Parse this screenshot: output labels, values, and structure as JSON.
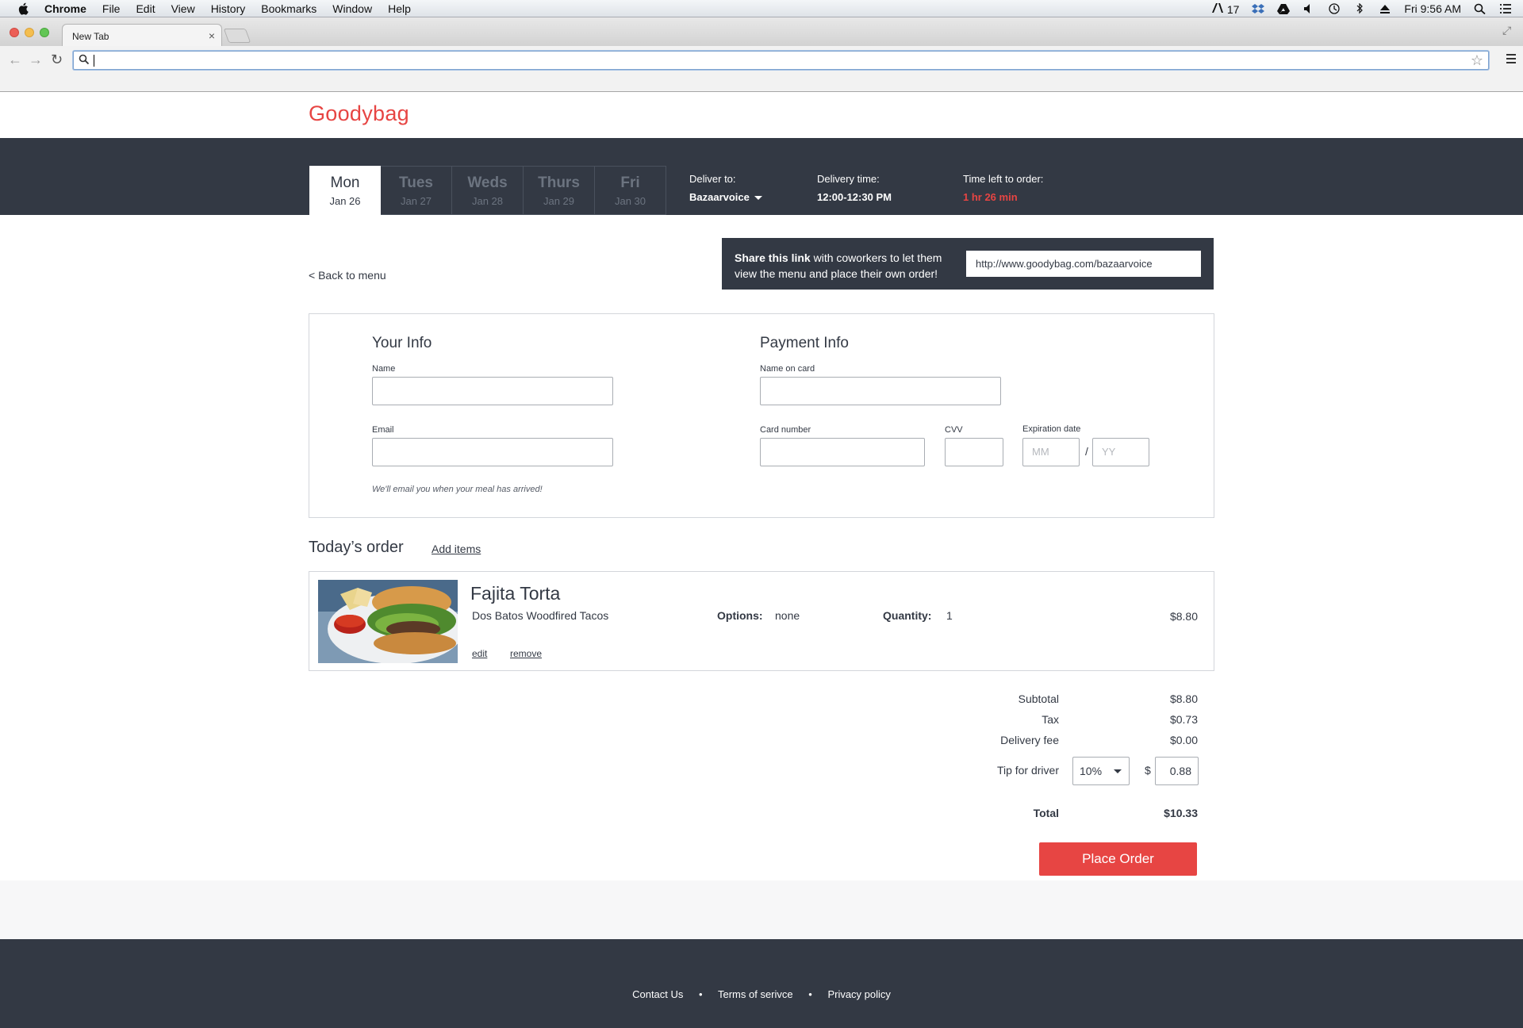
{
  "menubar": {
    "app": "Chrome",
    "items": [
      "File",
      "Edit",
      "View",
      "History",
      "Bookmarks",
      "Window",
      "Help"
    ],
    "adobe_count": "17",
    "clock": "Fri 9:56 AM"
  },
  "browser": {
    "tab_title": "New Tab",
    "tab_close": "×",
    "address_value": ""
  },
  "site": {
    "logo": "Goodybag",
    "days": [
      {
        "name": "Mon",
        "date": "Jan 26"
      },
      {
        "name": "Tues",
        "date": "Jan 27"
      },
      {
        "name": "Weds",
        "date": "Jan 28"
      },
      {
        "name": "Thurs",
        "date": "Jan 29"
      },
      {
        "name": "Fri",
        "date": "Jan 30"
      }
    ],
    "deliver_to_label": "Deliver to:",
    "deliver_to_value": "Bazaarvoice",
    "delivery_time_label": "Delivery time:",
    "delivery_time_value": "12:00-12:30 PM",
    "time_left_label": "Time left to order:",
    "time_left_value": "1 hr 26 min",
    "accent_color": "#e74543"
  },
  "share": {
    "back_link": "< Back to menu",
    "bold": "Share this link",
    "text": " with coworkers to let them view the menu and place their own order!",
    "url": "http://www.goodybag.com/bazaarvoice"
  },
  "your_info": {
    "title": "Your Info",
    "name_label": "Name",
    "email_label": "Email",
    "hint": "We'll email you when your meal has arrived!"
  },
  "payment_info": {
    "title": "Payment Info",
    "name_on_card_label": "Name on card",
    "card_number_label": "Card number",
    "cvv_label": "CVV",
    "expiration_label": "Expiration date",
    "mm_placeholder": "MM",
    "yy_placeholder": "YY",
    "slash": "/"
  },
  "order": {
    "heading": "Today’s order",
    "add_items": "Add items",
    "item": {
      "title": "Fajita Torta",
      "vendor": "Dos Batos Woodfired Tacos",
      "options_label": "Options:",
      "options_value": "none",
      "quantity_label": "Quantity:",
      "quantity_value": "1",
      "price": "$8.80",
      "edit": "edit",
      "remove": "remove"
    }
  },
  "summary": {
    "subtotal_label": "Subtotal",
    "subtotal_value": "$8.80",
    "tax_label": "Tax",
    "tax_value": "$0.73",
    "delivery_label": "Delivery fee",
    "delivery_value": "$0.00",
    "tip_label": "Tip for driver",
    "tip_percent": "10%",
    "tip_currency": "$",
    "tip_amount": "0.88",
    "total_label": "Total",
    "total_value": "$10.33",
    "place_order": "Place Order"
  },
  "footer": {
    "links": [
      "Contact Us",
      "Terms of serivce",
      "Privacy policy"
    ],
    "separator": "•"
  }
}
